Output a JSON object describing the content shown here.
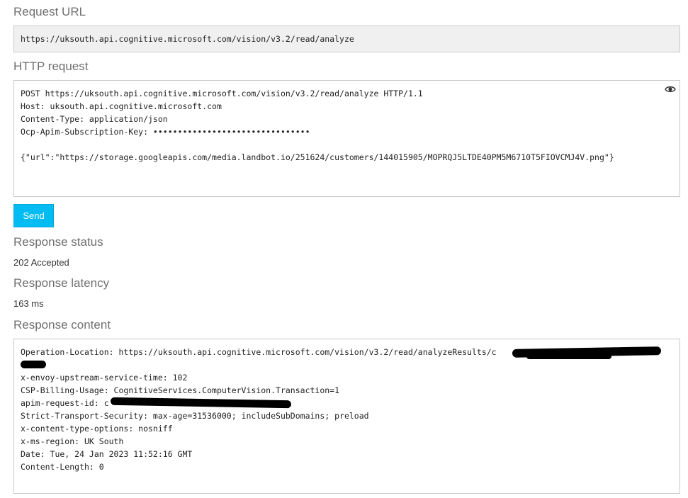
{
  "request_url": {
    "heading": "Request URL",
    "value": "https://uksouth.api.cognitive.microsoft.com/vision/v3.2/read/analyze"
  },
  "http_request": {
    "heading": "HTTP request",
    "lines": [
      "POST https://uksouth.api.cognitive.microsoft.com/vision/v3.2/read/analyze HTTP/1.1",
      "Host: uksouth.api.cognitive.microsoft.com",
      "Content-Type: application/json",
      "Ocp-Apim-Subscription-Key: ••••••••••••••••••••••••••••••••",
      "",
      "{\"url\":\"https://storage.googleapis.com/media.landbot.io/251624/customers/144015905/MOPRQJ5LTDE40PM5M6710T5FIOVCMJ4V.png\"}"
    ],
    "reveal_icon": "eye-icon"
  },
  "send_button": {
    "label": "Send"
  },
  "response_status": {
    "heading": "Response status",
    "value": "202 Accepted"
  },
  "response_latency": {
    "heading": "Response latency",
    "value": "163 ms"
  },
  "response_content": {
    "heading": "Response content",
    "lines": [
      "Operation-Location: https://uksouth.api.cognitive.microsoft.com/vision/v3.2/read/analyzeResults/c                          6",
      "",
      "x-envoy-upstream-service-time: 102",
      "CSP-Billing-Usage: CognitiveServices.ComputerVision.Transaction=1",
      "apim-request-id: c",
      "Strict-Transport-Security: max-age=31536000; includeSubDomains; preload",
      "x-content-type-options: nosniff",
      "x-ms-region: UK South",
      "Date: Tue, 24 Jan 2023 11:52:16 GMT",
      "Content-Length: 0"
    ]
  },
  "colors": {
    "accent": "#00bcf2",
    "heading": "#707070",
    "border": "#c8c8c8"
  }
}
